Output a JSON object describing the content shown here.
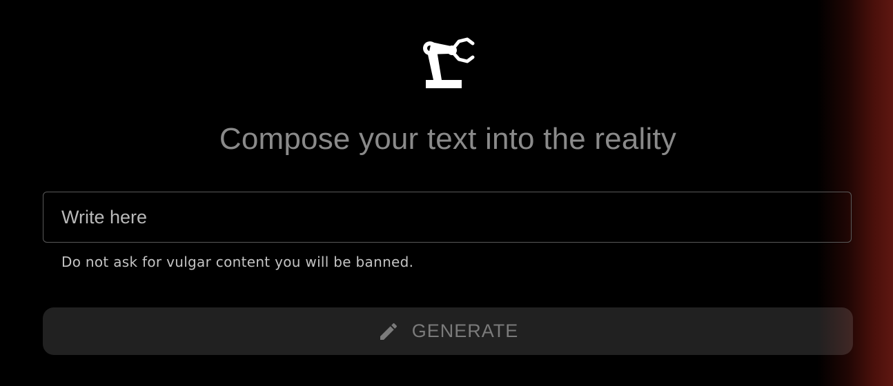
{
  "header": {
    "logo_icon": "robot-arm-icon",
    "headline": "Compose your text into the reality"
  },
  "prompt": {
    "placeholder": "Write here",
    "value": "",
    "helper_text": "Do not ask for vulgar content you will be banned."
  },
  "actions": {
    "generate_icon": "pencil-icon",
    "generate_label": "GENERATE"
  },
  "colors": {
    "background": "#000000",
    "edge_glow": "#5e1711",
    "headline": "#8a8a8a",
    "button_text": "#7b7b7b"
  }
}
